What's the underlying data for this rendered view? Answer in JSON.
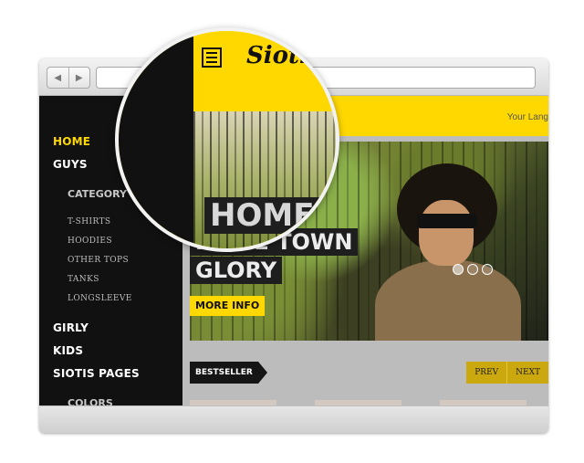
{
  "browser": {
    "back_icon": "triangle-left",
    "forward_icon": "triangle-right"
  },
  "site": {
    "logo": "Siotis",
    "language_label": "Your Lang"
  },
  "sidebar": {
    "items": [
      "HOME",
      "GUYS",
      "GIRLY",
      "KIDS",
      "SIOTIS PAGES"
    ],
    "category_heading": "CATEGORY",
    "category_items": [
      "T-SHIRTS",
      "HOODIES",
      "OTHER TOPS",
      "TANKS",
      "LONGSLEEVE"
    ],
    "colors_heading": "COLORS"
  },
  "hero": {
    "title_line1": "HOME TOWN",
    "title_line2": "GLORY",
    "button_label": "MORE INFO",
    "slide_count": 3,
    "active_slide": 1
  },
  "section": {
    "bestseller_label": "BESTSELLER",
    "prev_label": "PREV",
    "next_label": "NEXT"
  },
  "magnifier": {
    "title_text": "HOME",
    "menu_icon": "hamburger"
  },
  "colors": {
    "accent": "#ffd800",
    "sidebar_bg": "#111111",
    "pager_bg": "#cba80e"
  }
}
